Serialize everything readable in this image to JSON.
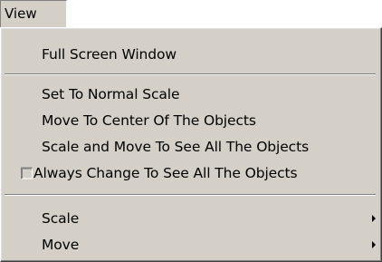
{
  "menubar": {
    "title": "View"
  },
  "menu": {
    "items": [
      {
        "label": "Full Screen Window"
      },
      {
        "label": "Set To Normal Scale"
      },
      {
        "label": "Move To Center Of The Objects"
      },
      {
        "label": "Scale and Move To See All The Objects"
      },
      {
        "label": "Always Change To See All The Objects",
        "checked": false
      },
      {
        "label": "Scale",
        "submenu": true
      },
      {
        "label": "Move",
        "submenu": true
      }
    ]
  },
  "icons": {
    "checkbox": "checkbox-icon",
    "submenu_arrow": "submenu-arrow-icon"
  },
  "colors": {
    "menu_background": "#d4d0c8",
    "text": "#000000"
  }
}
